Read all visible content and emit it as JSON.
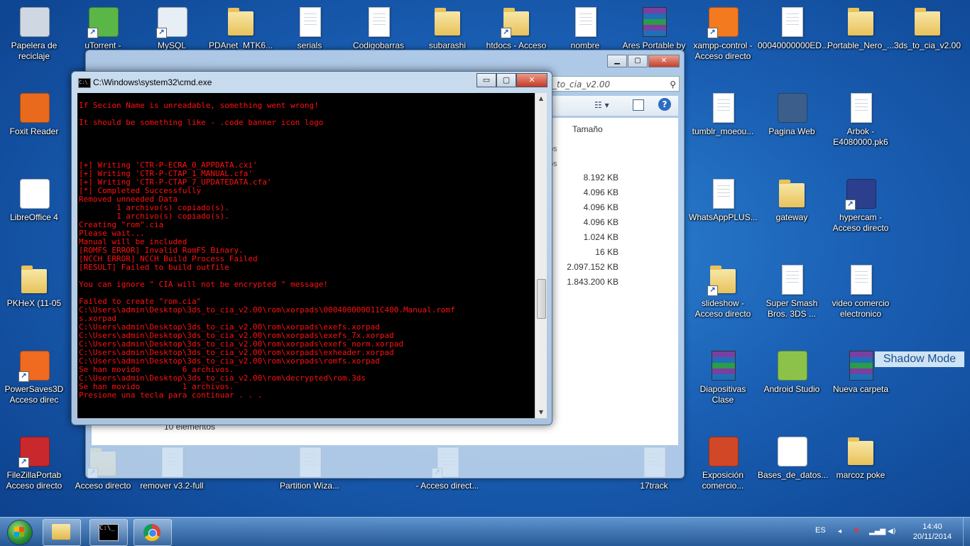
{
  "colors": {
    "console_text": "#ff1010",
    "console_bg": "#000000",
    "desktop_bg": "#1a5fb4"
  },
  "desktop": {
    "icons": [
      {
        "label": "Papelera de\nreciclaje",
        "icon": "recycle-bin-icon"
      },
      {
        "label": "uTorrent -",
        "icon": "utorrent-icon"
      },
      {
        "label": "MySQL",
        "icon": "mysql-workbench-icon"
      },
      {
        "label": "PDAnet_MTK6...",
        "icon": "folder-icon"
      },
      {
        "label": "serials",
        "icon": "text-file-icon"
      },
      {
        "label": "Codigobarras",
        "icon": "pdf-file-icon"
      },
      {
        "label": "subarashi",
        "icon": "folder-image-icon"
      },
      {
        "label": "htdocs - Acceso",
        "icon": "folder-shortcut-icon"
      },
      {
        "label": "nombre",
        "icon": "text-file-icon"
      },
      {
        "label": "Ares Portable by",
        "icon": "winrar-icon"
      },
      {
        "label": "xampp-control -\nAcceso directo",
        "icon": "xampp-icon"
      },
      {
        "label": "00040000000ED...",
        "icon": "file-icon"
      },
      {
        "label": "Portable_Nero_...",
        "icon": "folder-icon"
      },
      {
        "label": "3ds_to_cia_v2.00",
        "icon": "folder-icon"
      },
      {
        "label": "Foxit Reader",
        "icon": "foxit-icon"
      },
      {
        "label": "tumblr_moeou...",
        "icon": "file-icon"
      },
      {
        "label": "Pagina Web",
        "icon": "web-page-icon"
      },
      {
        "label": "Arbok -\nE4080000.pk6",
        "icon": "file-icon"
      },
      {
        "label": "LibreOffice 4",
        "icon": "libreoffice-icon"
      },
      {
        "label": "WhatsAppPLUS...",
        "icon": "file-icon"
      },
      {
        "label": "gateway",
        "icon": "folder-icon"
      },
      {
        "label": "hypercam -\nAcceso directo",
        "icon": "hypercam-icon"
      },
      {
        "label": "PKHeX (11-05",
        "icon": "folder-icon"
      },
      {
        "label": "slideshow -\nAcceso directo",
        "icon": "folder-shortcut-icon"
      },
      {
        "label": "Super Smash\nBros. 3DS ...",
        "icon": "text-file-icon"
      },
      {
        "label": "video comercio\nelectronico",
        "icon": "text-file-icon"
      },
      {
        "label": "PowerSaves3D\nAcceso direc",
        "icon": "powersaves-icon"
      },
      {
        "label": "Diapositivas\nClase",
        "icon": "winrar-icon"
      },
      {
        "label": "Android Studio",
        "icon": "android-studio-icon"
      },
      {
        "label": "Nueva carpeta",
        "icon": "winrar-icon"
      },
      {
        "label": "FileZillaPortab\nAcceso directo",
        "icon": "filezilla-icon"
      },
      {
        "label": "Acceso directo",
        "icon": "folder-icon"
      },
      {
        "label": "remover v3.2-full",
        "icon": "file-icon"
      },
      {
        "label": "Partition Wiza...",
        "icon": "file-icon"
      },
      {
        "label": "- Acceso direct...",
        "icon": "file-icon"
      },
      {
        "label": "17track",
        "icon": "file-icon"
      },
      {
        "label": "Exposición\ncomercio...",
        "icon": "powerpoint-icon"
      },
      {
        "label": "Bases_de_datos...",
        "icon": "pdf-document-icon"
      },
      {
        "label": "marcoz poke",
        "icon": "folder-icon"
      }
    ]
  },
  "explorer": {
    "address_text": "_to_cia_v2.00",
    "column_size_header": "Tamaño",
    "sizes": [
      "8.192 KB",
      "4.096 KB",
      "4.096 KB",
      "4.096 KB",
      "1.024 KB",
      "16 KB",
      "2.097.152 KB",
      "1.843.200 KB"
    ],
    "status_text": "10 elementos",
    "stub_texts": [
      "os",
      "os"
    ]
  },
  "cmd": {
    "title": "C:\\Windows\\system32\\cmd.exe",
    "icon_text": "C:\\",
    "lines": [
      "",
      "If Secion Name is unreadable, something went wrong!",
      "",
      "It should be something like - .code banner icon logo",
      "",
      "",
      "",
      "",
      "[+] Writing 'CTR-P-ECRA_0_APPDATA.cxi'",
      "[+] Writing 'CTR-P-CTAP_1_MANUAL.cfa'",
      "[+] Writing 'CTR-P-CTAP_7_UPDATEDATA.cfa'",
      "[*] Completed Successfully",
      "Removed unneeded Data",
      "        1 archivo(s) copiado(s).",
      "        1 archivo(s) copiado(s).",
      "Creating \"rom\".cia",
      "Please wait...",
      "Manual will be included",
      "[ROMFS ERROR] Invalid RomFS Binary.",
      "[NCCH ERROR] NCCH Build Process Failed",
      "[RESULT] Failed to build outfile",
      "",
      "You can ignore \" CIA will not be encrypted \" message!",
      "",
      "Failed to create \"rom.cia\"",
      "C:\\Users\\admin\\Desktop\\3ds_to_cia_v2.00\\rom\\xorpads\\000400000011C400.Manual.romf",
      "s.xorpad",
      "C:\\Users\\admin\\Desktop\\3ds_to_cia_v2.00\\rom\\xorpads\\exefs.xorpad",
      "C:\\Users\\admin\\Desktop\\3ds_to_cia_v2.00\\rom\\xorpads\\exefs_7x.xorpad",
      "C:\\Users\\admin\\Desktop\\3ds_to_cia_v2.00\\rom\\xorpads\\exefs_norm.xorpad",
      "C:\\Users\\admin\\Desktop\\3ds_to_cia_v2.00\\rom\\xorpads\\exheader.xorpad",
      "C:\\Users\\admin\\Desktop\\3ds_to_cia_v2.00\\rom\\xorpads\\romfs.xorpad",
      "Se han movido         6 archivos.",
      "C:\\Users\\admin\\Desktop\\3ds_to_cia_v2.00\\rom\\decrypted\\rom.3ds",
      "Se han movido         1 archivos.",
      "Presione una tecla para continuar . . ."
    ],
    "buttons": {
      "minimize": "▭",
      "maximize": "▢",
      "close": "✕"
    }
  },
  "overlay": {
    "shadow_mode": "Shadow Mode"
  },
  "taskbar": {
    "language": "ES",
    "time": "14:40",
    "date": "20/11/2014",
    "pinned": [
      "explorer-icon",
      "cmd-icon",
      "chrome-icon"
    ]
  }
}
